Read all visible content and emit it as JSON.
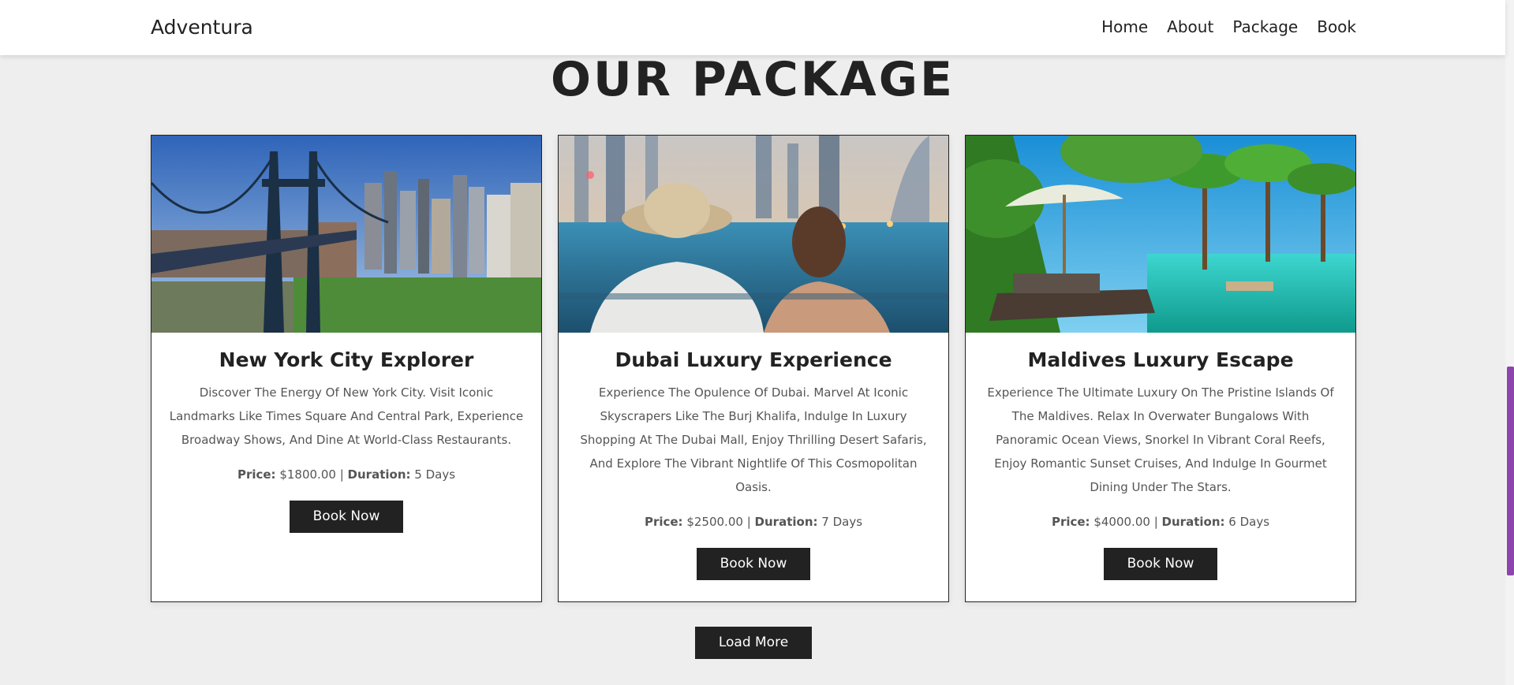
{
  "brand": "Adventura",
  "nav": [
    "Home",
    "About",
    "Package",
    "Book"
  ],
  "section_title": "OUR PACKAGE",
  "packages": [
    {
      "title": "New York City Explorer",
      "description": "Discover The Energy Of New York City. Visit Iconic Landmarks Like Times Square And Central Park, Experience Broadway Shows, And Dine At World-Class Restaurants.",
      "price_label": "Price:",
      "price": "$1800.00",
      "separator": "|",
      "duration_label": "Duration:",
      "duration": "5 Days",
      "button": "Book Now"
    },
    {
      "title": "Dubai Luxury Experience",
      "description": "Experience The Opulence Of Dubai. Marvel At Iconic Skyscrapers Like The Burj Khalifa, Indulge In Luxury Shopping At The Dubai Mall, Enjoy Thrilling Desert Safaris, And Explore The Vibrant Nightlife Of This Cosmopolitan Oasis.",
      "price_label": "Price:",
      "price": "$2500.00",
      "separator": "|",
      "duration_label": "Duration:",
      "duration": "7 Days",
      "button": "Book Now"
    },
    {
      "title": "Maldives Luxury Escape",
      "description": "Experience The Ultimate Luxury On The Pristine Islands Of The Maldives. Relax In Overwater Bungalows With Panoramic Ocean Views, Snorkel In Vibrant Coral Reefs, Enjoy Romantic Sunset Cruises, And Indulge In Gourmet Dining Under The Stars.",
      "price_label": "Price:",
      "price": "$4000.00",
      "separator": "|",
      "duration_label": "Duration:",
      "duration": "6 Days",
      "button": "Book Now"
    }
  ],
  "load_more": "Load More",
  "colors": {
    "background": "#eeeeee",
    "button": "#222222",
    "scrollbar_thumb": "#8e44ad"
  }
}
